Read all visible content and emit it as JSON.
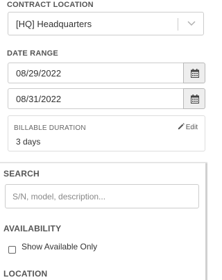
{
  "contract_location": {
    "label": "CONTRACT LOCATION",
    "selected_value": "[HQ] Headquarters",
    "chevron_icon": "chevron-down-icon"
  },
  "date_range": {
    "label": "DATE RANGE",
    "start_date": "08/29/2022",
    "end_date": "08/31/2022",
    "calendar_icon": "calendar-icon"
  },
  "billable_duration": {
    "label": "BILLABLE DURATION",
    "value": "3 days",
    "edit_label": "Edit",
    "edit_icon": "pencil-icon"
  },
  "search": {
    "label": "SEARCH",
    "placeholder": "S/N, model, description...",
    "value": ""
  },
  "availability": {
    "label": "AVAILABILITY",
    "checkbox_label": "Show Available Only",
    "checked": false
  },
  "location": {
    "label": "LOCATION"
  }
}
